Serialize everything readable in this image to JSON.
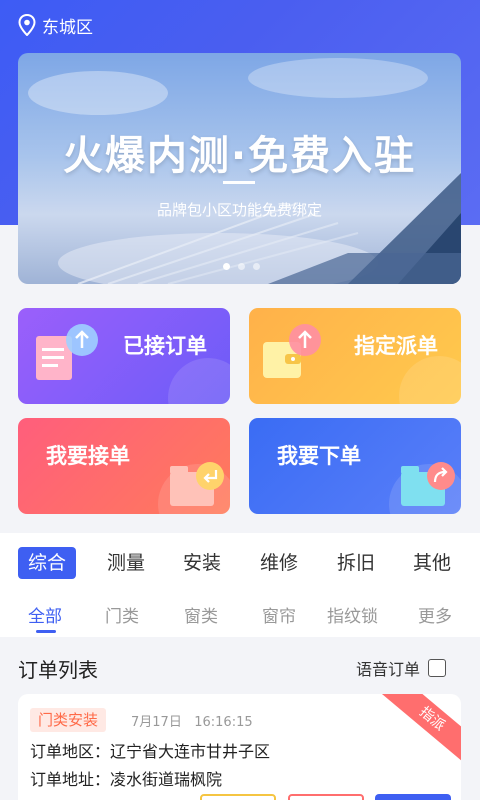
{
  "header": {
    "location": "东城区"
  },
  "banner": {
    "title": "火爆内测·免费入驻",
    "subtitle": "品牌包小区功能免费绑定",
    "slide_count": 3,
    "active_slide": 0
  },
  "actions": [
    {
      "label": "已接订单",
      "icon": "clipboard-upload-icon"
    },
    {
      "label": "指定派单",
      "icon": "wallet-upload-icon"
    },
    {
      "label": "我要接单",
      "icon": "folder-return-icon"
    },
    {
      "label": "我要下单",
      "icon": "folder-share-icon"
    }
  ],
  "categories": [
    "综合",
    "测量",
    "安装",
    "维修",
    "拆旧",
    "其他"
  ],
  "active_category": "综合",
  "subtabs": [
    "全部",
    "门类",
    "窗类",
    "窗帘",
    "指纹锁",
    "更多"
  ],
  "active_subtab": "全部",
  "order_list": {
    "title": "订单列表",
    "voice_order_label": "语音订单",
    "voice_order_checked": false
  },
  "order": {
    "tag": "门类安装",
    "date": "7月17日",
    "time": "16:16:15",
    "ribbon": "指派",
    "area_label": "订单地区：",
    "area_value": "辽宁省大连市甘井子区",
    "address_label": "订单地址：",
    "address_value": "凌水街道瑞枫院"
  },
  "colors": {
    "primary": "#3e5ff2",
    "tag_text": "#ff6a48",
    "ribbon": "#ff6e6e"
  }
}
